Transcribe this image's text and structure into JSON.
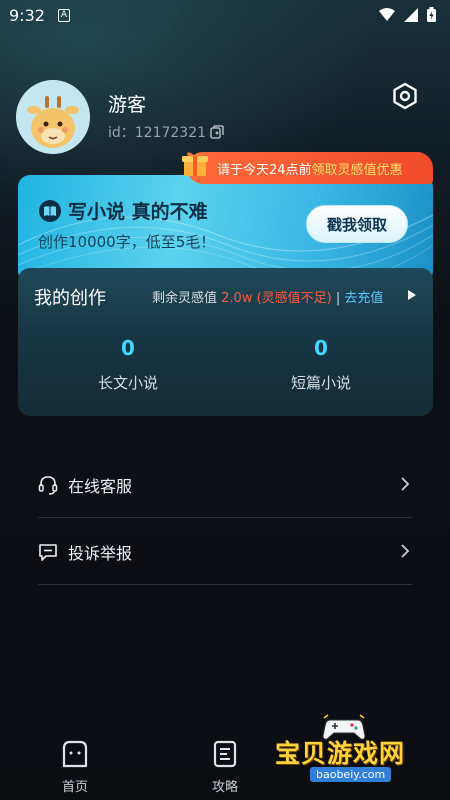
{
  "status_bar": {
    "time": "9:32",
    "notification_icon": "A"
  },
  "profile": {
    "username": "游客",
    "id_label": "id：12172321"
  },
  "promo_ribbon": {
    "prefix": "请于今天24点前",
    "highlight": "领取灵感值优惠"
  },
  "banner": {
    "title": "写小说 真的不难",
    "subtitle": "创作10000字，低至5毛！",
    "cta": "戳我领取"
  },
  "creation": {
    "heading": "我的创作",
    "remaining_label": "剩余灵感值",
    "remaining_value": "2.0w (灵感值不足)",
    "separator": "|",
    "recharge": "去充值",
    "stats": [
      {
        "value": "0",
        "label": "长文小说"
      },
      {
        "value": "0",
        "label": "短篇小说"
      }
    ]
  },
  "menu": [
    {
      "label": "在线客服",
      "icon": "headset-icon"
    },
    {
      "label": "投诉举报",
      "icon": "report-icon"
    }
  ],
  "nav": [
    {
      "label": "首页",
      "icon": "home-icon"
    },
    {
      "label": "攻略",
      "icon": "guide-icon"
    }
  ],
  "watermark": {
    "text": "宝贝游戏网",
    "url": "baobeiy.com"
  },
  "colors": {
    "accent": "#3fd8ff",
    "warning": "#ff5a3c",
    "ribbon": "#f04a2a",
    "banner": "#3ab8e4"
  }
}
